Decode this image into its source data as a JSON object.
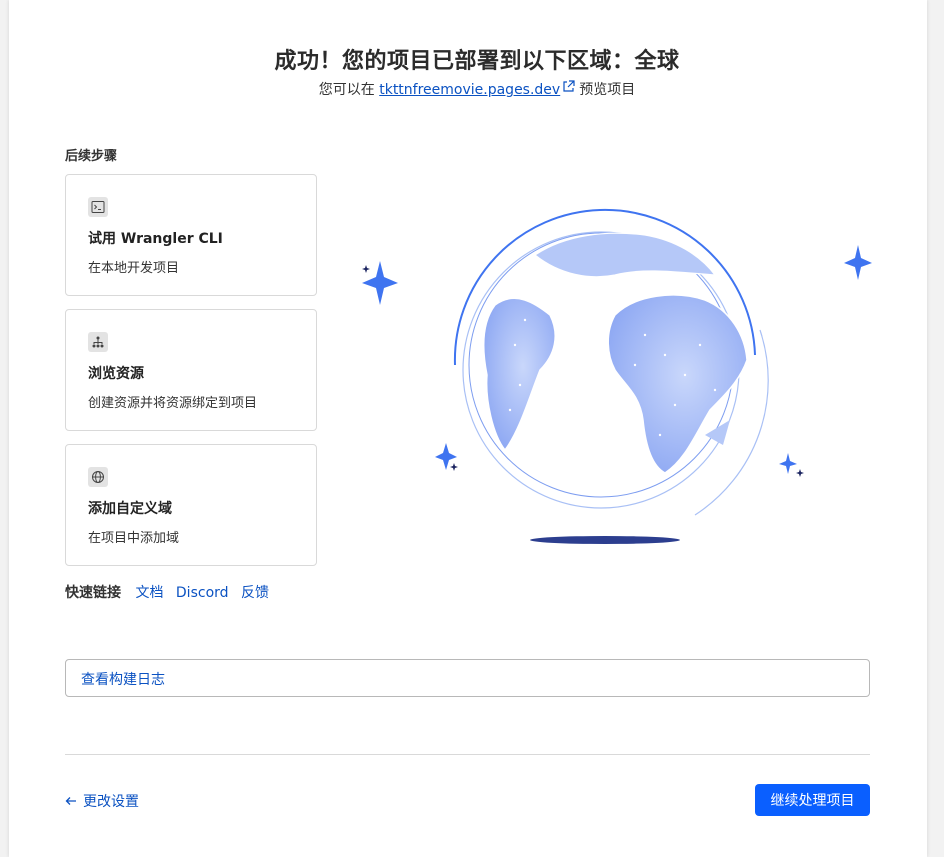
{
  "header": {
    "title": "成功！您的项目已部署到以下区域：全球",
    "subtitle_prefix": "您可以在",
    "project_url": "tkttnfreemovie.pages.dev",
    "subtitle_suffix": "预览项目"
  },
  "next_steps": {
    "label": "后续步骤",
    "cards": [
      {
        "icon": "terminal-icon",
        "title": "试用 Wrangler CLI",
        "description": "在本地开发项目"
      },
      {
        "icon": "resources-icon",
        "title": "浏览资源",
        "description": "创建资源并将资源绑定到项目"
      },
      {
        "icon": "globe-icon",
        "title": "添加自定义域",
        "description": "在项目中添加域"
      }
    ]
  },
  "quick_links": {
    "label": "快速链接",
    "items": [
      "文档",
      "Discord",
      "反馈"
    ]
  },
  "build_log": {
    "label": "查看构建日志"
  },
  "footer": {
    "back_label": "更改设置",
    "continue_label": "继续处理项目"
  },
  "colors": {
    "accent": "#0a5fff",
    "link": "#0b52c2",
    "globe_fill": "#9cb6f7",
    "sparkle": "#3f74f0"
  }
}
